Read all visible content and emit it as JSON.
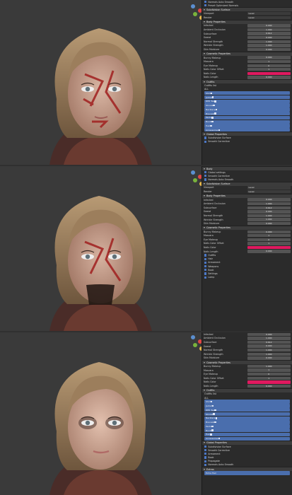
{
  "colors": {
    "viewport": "#3a3a3a",
    "panel": "#2b2b2b",
    "accent_blue": "#4a6ead",
    "accent_pink": "#e0195f",
    "header": "#3c3c3c"
  },
  "panel1": {
    "top_checks": [
      "Normals Auto Smooth",
      "Preset Optimized Normals"
    ],
    "subdivision_header": "Subdivision Surface",
    "sub_rows": [
      {
        "label": "Viewport",
        "value": "Level"
      },
      {
        "label": "Render",
        "value": "Level"
      }
    ],
    "body_header": "Body Properties",
    "body_rows": [
      {
        "label": "Infected",
        "value": "0.000"
      },
      {
        "label": "Ambient Occlusion",
        "value": "1.000"
      },
      {
        "label": "Subsurface",
        "value": "0.612"
      },
      {
        "label": "Sweat",
        "value": "0.000"
      },
      {
        "label": "Normal Strength",
        "value": "1.000"
      },
      {
        "label": "Wrinkle Strength",
        "value": "1.000"
      },
      {
        "label": "Skin Moisture",
        "value": "0.000"
      }
    ],
    "cosmetic_header": "Cosmetic Properties",
    "cosmetic_rows": [
      {
        "label": "Bunny Makeup",
        "value": "0.000"
      },
      {
        "label": "Mascara",
        "value": "1"
      },
      {
        "label": "Eye Makeup",
        "value": "0"
      },
      {
        "label": "Nails Color Offset",
        "value": "1"
      },
      {
        "label": "Nails Color",
        "value": "",
        "pink": true
      },
      {
        "label": "Nails Length",
        "value": "0.000"
      }
    ],
    "outfits_header": "Outfits",
    "outfit_list_label": "Outfits list",
    "list_title": "ALL",
    "outfit_buttons": [
      "Shirt",
      "Jacket",
      "RPD Tee",
      "Gloves",
      "Necklace",
      "Bracelet",
      "Pants",
      "Boots",
      "Hair",
      "Accessories"
    ],
    "global_header": "Global Properties",
    "global_checks": [
      "Subdivision Surface",
      "Smooth Corrective"
    ]
  },
  "panel2": {
    "top_header": "Body",
    "top_checks": [
      "Global settings",
      "Smooth Corrective",
      "Normals Auto Smooth"
    ],
    "subdivision_header": "Subdivision Surface",
    "sub_rows": [
      {
        "label": "Viewport",
        "value": "Level"
      },
      {
        "label": "Render",
        "value": "Level"
      }
    ],
    "body_header": "Body Properties",
    "body_rows": [
      {
        "label": "Infected",
        "value": "0.000"
      },
      {
        "label": "Ambient Occlusion",
        "value": "1.000"
      },
      {
        "label": "Subsurface",
        "value": "0.612"
      },
      {
        "label": "Sweat",
        "value": "0.000"
      },
      {
        "label": "Normal Strength",
        "value": "1.000"
      },
      {
        "label": "Wrinkle Strength",
        "value": "1.000"
      },
      {
        "label": "Skin Moisture",
        "value": "0.000"
      }
    ],
    "cosmetic_header": "Cosmetic Properties",
    "cosmetic_rows": [
      {
        "label": "Bunny Makeup",
        "value": "0.000"
      },
      {
        "label": "Mascara",
        "value": "1"
      },
      {
        "label": "Eye Makeup",
        "value": "0"
      },
      {
        "label": "Nails Color Offset",
        "value": "1"
      },
      {
        "label": "Nails Color",
        "value": "",
        "pink": true
      },
      {
        "label": "Nails Length",
        "value": "0.000"
      }
    ],
    "outfit_checks": [
      "Outfits",
      "Hair",
      "Armament",
      "Weapons",
      "Book",
      "Settings",
      "Lamp"
    ]
  },
  "panel3": {
    "body_rows": [
      {
        "label": "Infected",
        "value": "0.000"
      },
      {
        "label": "Ambient Occlusion",
        "value": "1.000"
      },
      {
        "label": "Subsurface",
        "value": "0.612"
      },
      {
        "label": "Sweat",
        "value": "0.000"
      },
      {
        "label": "Normal Strength",
        "value": "1.000"
      },
      {
        "label": "Wrinkle Strength",
        "value": "1.000"
      },
      {
        "label": "Skin Moisture",
        "value": "0.000"
      }
    ],
    "cosmetic_header": "Cosmetic Properties",
    "cosmetic_rows": [
      {
        "label": "Bunny Makeup",
        "value": "1.000"
      },
      {
        "label": "Mascara",
        "value": "1"
      },
      {
        "label": "Eye Makeup",
        "value": "0"
      },
      {
        "label": "Nails Color Offset",
        "value": "1"
      },
      {
        "label": "Nails Color",
        "value": "",
        "pink": true
      },
      {
        "label": "Nails Length",
        "value": "0.000"
      }
    ],
    "outfits_header": "Outfits",
    "outfit_list_label": "Outfits list",
    "list_title": "ALL",
    "outfit_buttons": [
      "Shirt",
      "Jacket",
      "RPD Tee",
      "Gloves",
      "Necklace",
      "Bracelet",
      "Pants",
      "Boots",
      "Hair",
      "Accessories"
    ],
    "global_header": "Global Properties",
    "global_checks": [
      "Subdivision Surface",
      "Smooth Corrective",
      "Armament",
      "Book",
      "Propagate",
      "Normals Auto Smooth"
    ],
    "extras_header": "Extras",
    "extras_button": "Extra Hair"
  }
}
